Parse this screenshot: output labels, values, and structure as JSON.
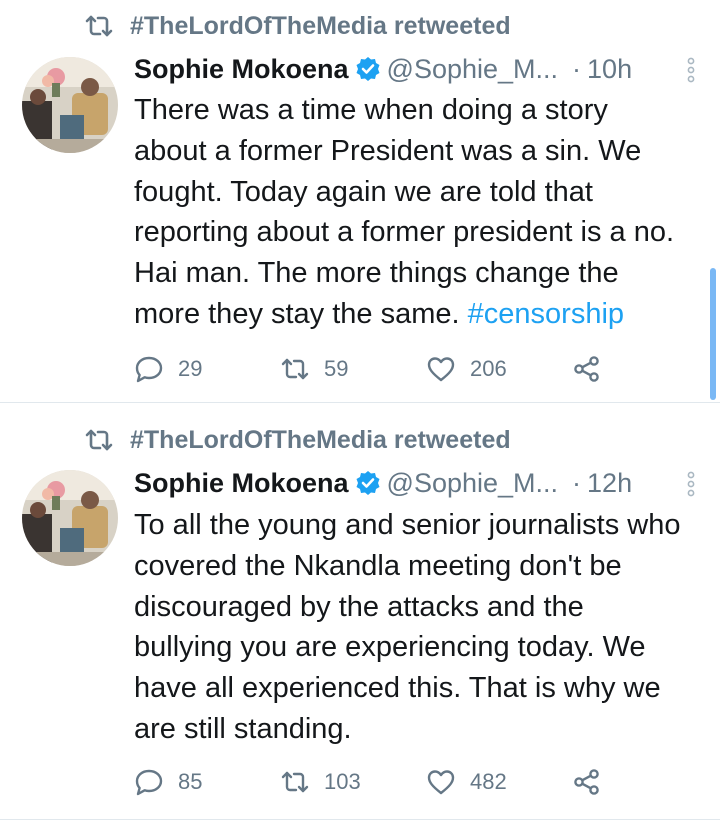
{
  "tweets": [
    {
      "retweeted_by": "#TheLordOfTheMedia retweeted",
      "author_name": "Sophie Mokoena",
      "handle": "@Sophie_M...",
      "separator": "·",
      "time": "10h",
      "lines": [
        "There was a time when doing a story",
        "about a former President was a sin. We",
        "fought. Today again we are told that",
        "reporting about a former president is a no.",
        "Hai man. The more things change the",
        "more they stay the same. "
      ],
      "hashtag": "#censorship",
      "replies": "29",
      "retweets": "59",
      "likes": "206"
    },
    {
      "retweeted_by": "#TheLordOfTheMedia retweeted",
      "author_name": "Sophie Mokoena",
      "handle": "@Sophie_M...",
      "separator": "·",
      "time": "12h",
      "lines": [
        "To all the young and senior journalists who",
        "covered the Nkandla meeting don't be",
        "discouraged by the attacks and the",
        "bullying you are experiencing today. We",
        "have all experienced this. That is why we",
        "are still standing."
      ],
      "replies": "85",
      "retweets": "103",
      "likes": "482"
    }
  ],
  "colors": {
    "text": "#14171a",
    "secondary": "#657786",
    "accent": "#1da1f2",
    "divider": "#e1e8ed"
  },
  "icons": [
    "retweet-icon",
    "verified-badge-icon",
    "more-icon",
    "reply-icon",
    "like-icon",
    "share-icon"
  ]
}
